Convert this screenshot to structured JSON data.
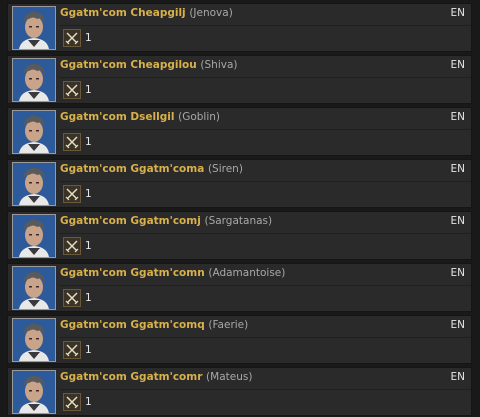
{
  "entries": [
    {
      "name": "Ggatm'com Cheapgilj",
      "world": "(Jenova)",
      "lang": "EN",
      "level": "1",
      "job_icon": "swords-icon"
    },
    {
      "name": "Ggatm'com Cheapgilou",
      "world": "(Shiva)",
      "lang": "EN",
      "level": "1",
      "job_icon": "swords-icon"
    },
    {
      "name": "Ggatm'com Dsellgil",
      "world": "(Goblin)",
      "lang": "EN",
      "level": "1",
      "job_icon": "swords-icon"
    },
    {
      "name": "Ggatm'com Ggatm'coma",
      "world": "(Siren)",
      "lang": "EN",
      "level": "1",
      "job_icon": "swords-icon"
    },
    {
      "name": "Ggatm'com Ggatm'comj",
      "world": "(Sargatanas)",
      "lang": "EN",
      "level": "1",
      "job_icon": "swords-icon"
    },
    {
      "name": "Ggatm'com Ggatm'comn",
      "world": "(Adamantoise)",
      "lang": "EN",
      "level": "1",
      "job_icon": "swords-icon"
    },
    {
      "name": "Ggatm'com Ggatm'comq",
      "world": "(Faerie)",
      "lang": "EN",
      "level": "1",
      "job_icon": "swords-icon"
    },
    {
      "name": "Ggatm'com Ggatm'comr",
      "world": "(Mateus)",
      "lang": "EN",
      "level": "1",
      "job_icon": "swords-icon"
    }
  ],
  "colors": {
    "name": "#d9b14a",
    "world": "#a8a8a8",
    "row_bg": "#2a2a2a",
    "avatar_bg": "#2d5a9a"
  }
}
